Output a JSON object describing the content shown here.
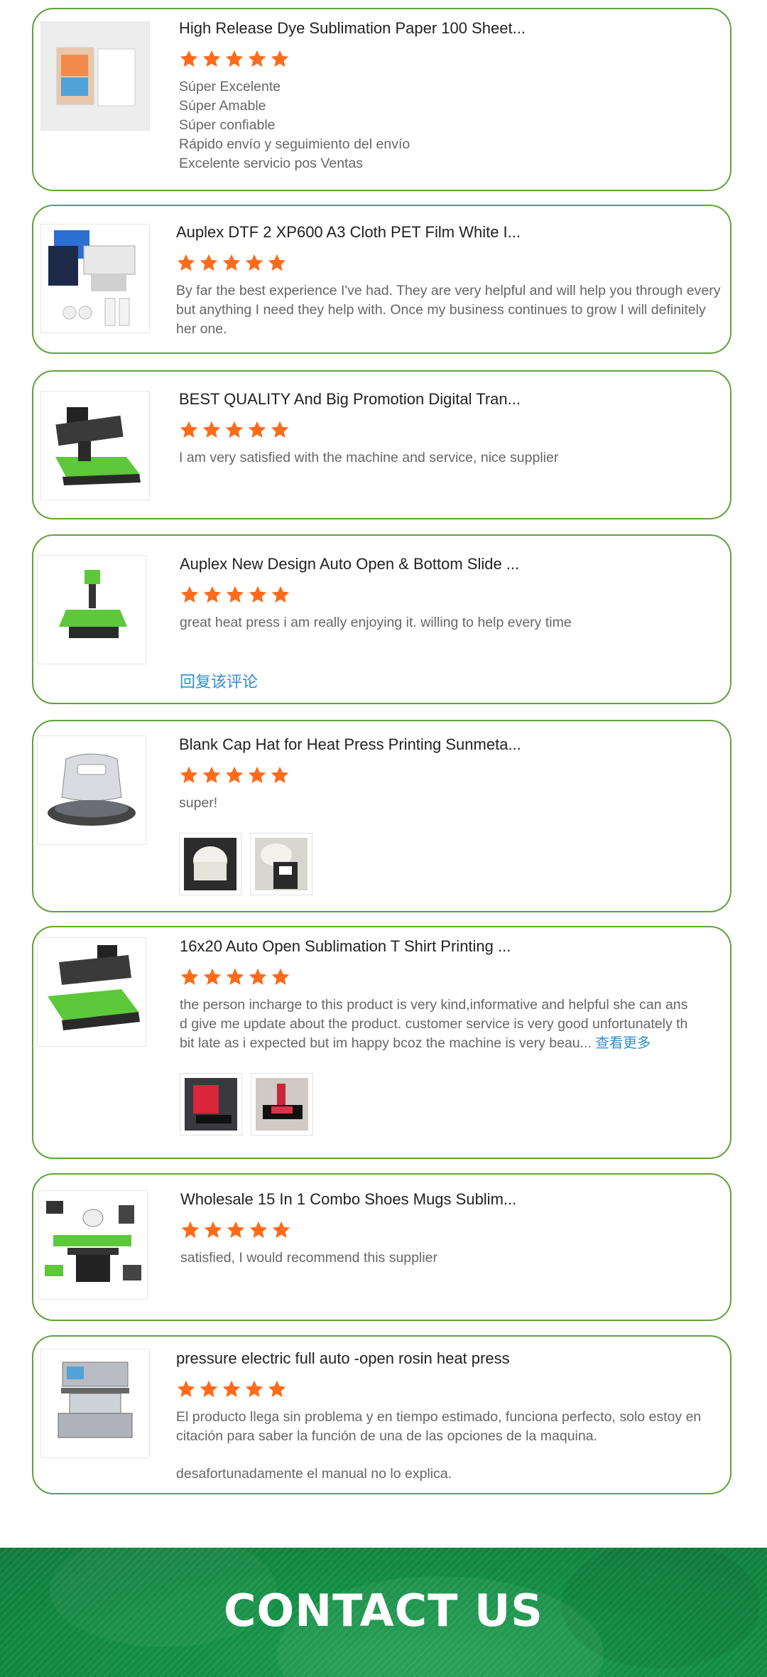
{
  "colors": {
    "card_border": "#5fa33a",
    "star": "#ff6b1a",
    "link": "#2f8fcf",
    "contact_bg": "#138f45"
  },
  "reviews": [
    {
      "title": "High Release Dye Sublimation Paper 100 Sheet...",
      "rating": 5,
      "lines": [
        "Súper Excelente",
        "Súper Amable",
        "Súper confiable",
        "Rápido envío y seguimiento del envío",
        "Excelente servicio pos Ventas"
      ],
      "icon": "sublimation-paper-image"
    },
    {
      "title": "Auplex DTF 2 XP600 A3 Cloth PET Film White I...",
      "rating": 5,
      "lines": [
        "By far the best experience I've had. They are very helpful and will help you through every",
        "but anything I need they help with. Once my business continues to grow I will definitely",
        "her one."
      ],
      "icon": "dtf-printer-image"
    },
    {
      "title": "BEST QUALITY And Big Promotion Digital Tran...",
      "rating": 5,
      "lines": [
        "I am very satisfied with the machine and service, nice supplier"
      ],
      "icon": "heat-press-image"
    },
    {
      "title": "Auplex New Design Auto Open & Bottom Slide ...",
      "rating": 5,
      "lines": [
        "great heat press i am really enjoying it. willing to help every time"
      ],
      "reply": "回复该评论",
      "icon": "heat-press-image"
    },
    {
      "title": "Blank Cap Hat for Heat Press Printing Sunmeta...",
      "rating": 5,
      "lines": [
        "super!"
      ],
      "icon": "cap-press-image"
    },
    {
      "title": "16x20 Auto Open Sublimation T Shirt Printing ...",
      "rating": 5,
      "lines": [
        "the person incharge to this product is very kind,informative and helpful she can ans",
        "d give me update about the product. customer service is very good unfortunately th",
        "bit late as i expected but im happy bcoz the machine is very beau..."
      ],
      "more": "查看更多",
      "icon": "heat-press-image"
    },
    {
      "title": "Wholesale 15 In 1 Combo Shoes Mugs Sublim...",
      "rating": 5,
      "lines": [
        "satisfied, I would recommend this supplier"
      ],
      "icon": "combo-press-image"
    },
    {
      "title": "pressure electric full auto -open rosin heat press",
      "rating": 5,
      "lines": [
        "El producto llega sin problema y en tiempo estimado,  funciona perfecto,  solo estoy en",
        "citación para saber la función de una de las opciones de la maquina.",
        "",
        "desafortunadamente el manual no lo explica."
      ],
      "icon": "rosin-press-image"
    }
  ],
  "contact": {
    "title": "CONTACT US"
  }
}
